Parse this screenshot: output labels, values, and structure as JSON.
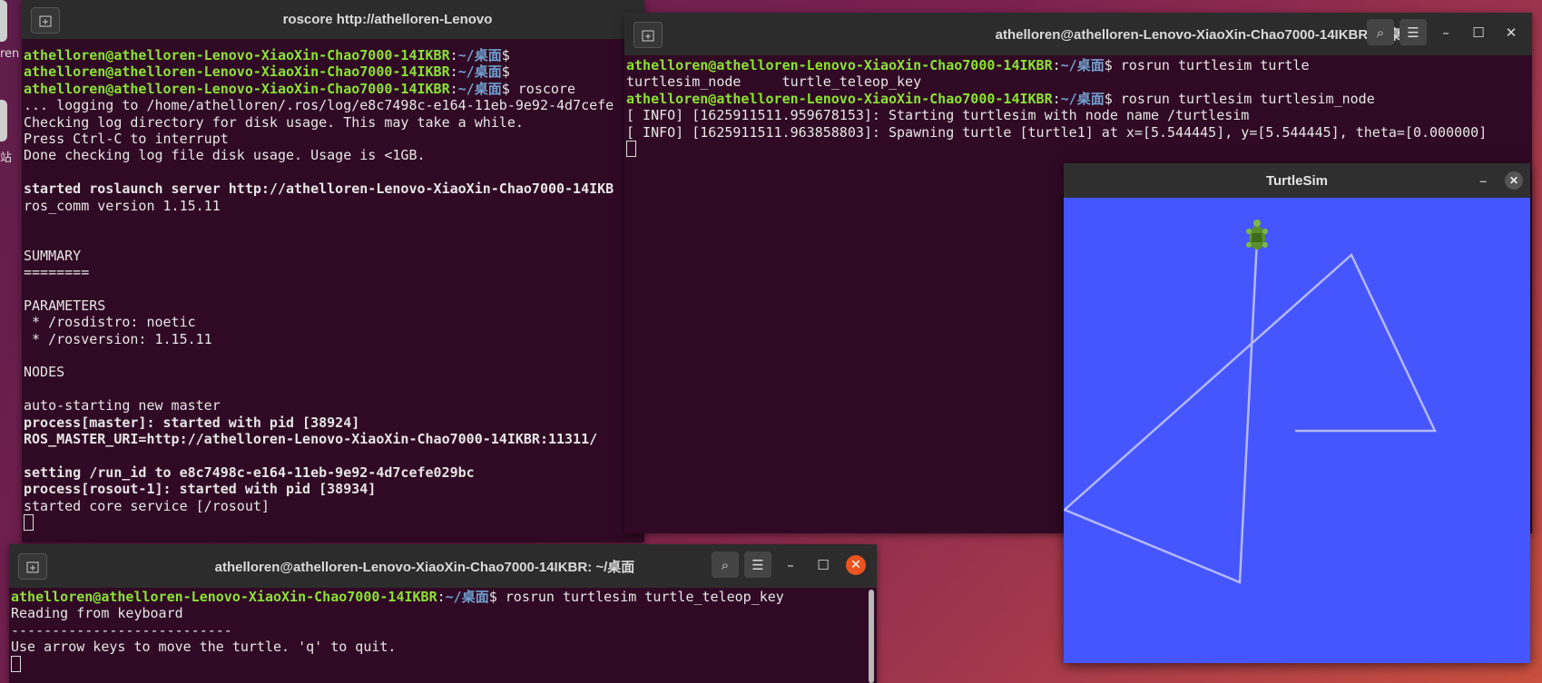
{
  "desktop": {
    "dock_label_top": "ren",
    "dock_label_mid": "站"
  },
  "roscore_window": {
    "title": "roscore http://athelloren-Lenovo",
    "lines": [
      {
        "user": "athelloren@athelloren-Lenovo-XiaoXin-Chao7000-14IKBR",
        "path": "~/桌面",
        "cmd": "$"
      },
      {
        "user": "athelloren@athelloren-Lenovo-XiaoXin-Chao7000-14IKBR",
        "path": "~/桌面",
        "cmd": "$"
      },
      {
        "user": "athelloren@athelloren-Lenovo-XiaoXin-Chao7000-14IKBR",
        "path": "~/桌面",
        "cmd": "$ roscore"
      },
      {
        "text": "... logging to /home/athelloren/.ros/log/e8c7498c-e164-11eb-9e92-4d7cefe"
      },
      {
        "text": "Checking log directory for disk usage. This may take a while."
      },
      {
        "text": "Press Ctrl-C to interrupt"
      },
      {
        "text": "Done checking log file disk usage. Usage is <1GB."
      },
      {
        "text": ""
      },
      {
        "text": "started roslaunch server http://athelloren-Lenovo-XiaoXin-Chao7000-14IKB",
        "bold": true
      },
      {
        "text": "ros_comm version 1.15.11"
      },
      {
        "text": ""
      },
      {
        "text": ""
      },
      {
        "text": "SUMMARY"
      },
      {
        "text": "========"
      },
      {
        "text": ""
      },
      {
        "text": "PARAMETERS"
      },
      {
        "text": " * /rosdistro: noetic"
      },
      {
        "text": " * /rosversion: 1.15.11"
      },
      {
        "text": ""
      },
      {
        "text": "NODES"
      },
      {
        "text": ""
      },
      {
        "text": "auto-starting new master"
      },
      {
        "text": "process[master]: started with pid [38924]",
        "bold": true
      },
      {
        "text": "ROS_MASTER_URI=http://athelloren-Lenovo-XiaoXin-Chao7000-14IKBR:11311/",
        "bold": true
      },
      {
        "text": ""
      },
      {
        "text": "setting /run_id to e8c7498c-e164-11eb-9e92-4d7cefe029bc",
        "bold": true
      },
      {
        "text": "process[rosout-1]: started with pid [38934]",
        "bold": true
      },
      {
        "text": "started core service [/rosout]"
      }
    ]
  },
  "node_window": {
    "title": "athelloren@athelloren-Lenovo-XiaoXin-Chao7000-14IKBR: ~/桌面",
    "lines": [
      {
        "user": "athelloren@athelloren-Lenovo-XiaoXin-Chao7000-14IKBR",
        "path": "~/桌面",
        "cmd": "$ rosrun turtlesim turtle"
      },
      {
        "text": "turtlesim_node     turtle_teleop_key"
      },
      {
        "user": "athelloren@athelloren-Lenovo-XiaoXin-Chao7000-14IKBR",
        "path": "~/桌面",
        "cmd": "$ rosrun turtlesim turtlesim_node"
      },
      {
        "text": "[ INFO] [1625911511.959678153]: Starting turtlesim with node name /turtlesim"
      },
      {
        "text": "[ INFO] [1625911511.963858803]: Spawning turtle [turtle1] at x=[5.544445], y=[5.544445], theta=[0.000000]"
      }
    ]
  },
  "teleop_window": {
    "title": "athelloren@athelloren-Lenovo-XiaoXin-Chao7000-14IKBR: ~/桌面",
    "lines": [
      {
        "user": "athelloren@athelloren-Lenovo-XiaoXin-Chao7000-14IKBR",
        "path": "~/桌面",
        "cmd": "$ rosrun turtlesim turtle_teleop_key"
      },
      {
        "text": "Reading from keyboard"
      },
      {
        "text": "---------------------------"
      },
      {
        "text": "Use arrow keys to move the turtle. 'q' to quit."
      }
    ]
  },
  "turtlesim_window": {
    "title": "TurtleSim",
    "colors": {
      "background": "#4556ff",
      "pen": "#b3b8ff",
      "turtle": "#5a8f2e"
    }
  },
  "icons": {
    "new_tab": "new-tab-icon",
    "search": "search-icon",
    "menu": "hamburger-menu-icon",
    "minimize": "minimize-icon",
    "maximize": "maximize-icon",
    "close": "close-icon"
  }
}
